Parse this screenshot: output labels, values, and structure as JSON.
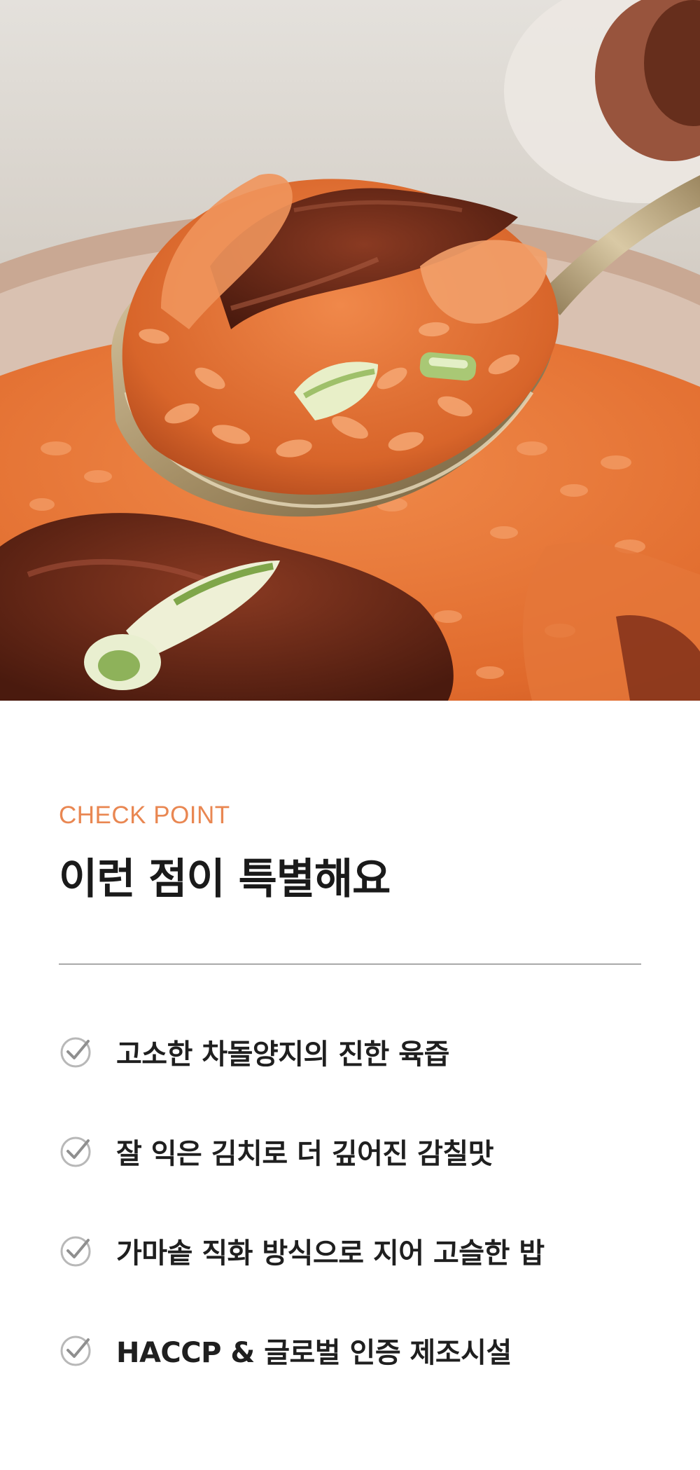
{
  "hero": {
    "image_description_icon": "kimchi-fried-rice-photo"
  },
  "section": {
    "eyebrow": "CHECK POINT",
    "headline": "이런 점이 특별해요"
  },
  "points": [
    "고소한 차돌양지의 진한 육즙",
    "잘 익은 김치로 더 깊어진 감칠맛",
    "가마솥 직화 방식으로 지어 고슬한 밥",
    "HACCP & 글로벌 인증 제조시설"
  ],
  "colors": {
    "accent": "#e98752",
    "headline": "#1a1a1a",
    "divider": "#a9a9a9",
    "check": "#b8b8b8"
  }
}
